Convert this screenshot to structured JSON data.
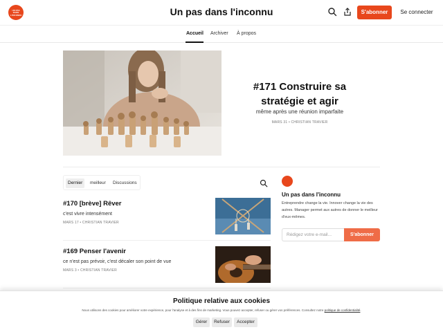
{
  "header": {
    "logo_text": "UN PAS DANS L'INCONNU",
    "site_title": "Un pas dans l'inconnu",
    "search_icon": "search-icon",
    "share_icon": "share-icon",
    "subscribe_label": "S'abonner",
    "login_label": "Se connecter"
  },
  "nav": {
    "tabs": [
      {
        "label": "Accueil",
        "active": true
      },
      {
        "label": "Archiver",
        "active": false
      },
      {
        "label": "À propos",
        "active": false
      }
    ]
  },
  "featured": {
    "title": "#171 Construire sa stratégie et agir",
    "subtitle": "même après une réunion imparfaite",
    "meta": "MARS 31 • CHRISTIAN TRAVIER"
  },
  "feed": {
    "tabs": [
      {
        "label": "Dernier",
        "active": true
      },
      {
        "label": "meilleur",
        "active": false
      },
      {
        "label": "Discussions",
        "active": false
      }
    ],
    "posts": [
      {
        "title": "#170 [brève] Rêver",
        "subtitle": "c'est vivre intensément",
        "meta": "MARS 17 • CHRISTIAN TRAVIER"
      },
      {
        "title": "#169 Penser l'avenir",
        "subtitle": "ce n'est pas prévoir, c'est décaler son point de vue",
        "meta": "MARS 3 • CHRISTIAN TRAVIER"
      }
    ]
  },
  "sidebar": {
    "title": "Un pas dans l'inconnu",
    "description": "Entreprendre change la vie. Innover change la vie des autres. Manager permet aux autres de donner le meilleur d'eux-mêmes.",
    "email_placeholder": "Rédigez votre e-mail...",
    "subscribe_label": "S'abonner"
  },
  "cookie": {
    "title": "Politique relative aux cookies",
    "text": "Nous utilisons des cookies pour améliorer votre expérience, pour l'analyse et à des fins de marketing. Vous pouvez accepter, refuser ou gérer vos préférences. Consultez notre",
    "link": "politique de confidentialité",
    "manage_label": "Gérer",
    "refuse_label": "Refuser",
    "accept_label": "Accepter"
  },
  "colors": {
    "accent": "#e8471c",
    "accent_light": "#ef6c47"
  }
}
